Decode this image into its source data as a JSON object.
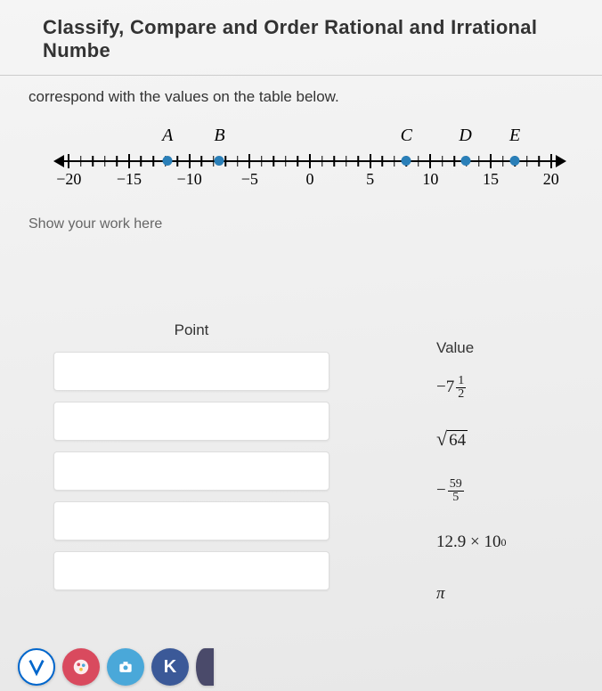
{
  "title": "Classify, Compare and Order Rational and Irrational Numbe",
  "instruction": "correspond with the values on the table below.",
  "number_line": {
    "min": -20,
    "max": 20,
    "ticks": [
      -20,
      -15,
      -10,
      -5,
      0,
      5,
      10,
      15,
      20
    ],
    "point_letters": [
      "A",
      "B",
      "C",
      "D",
      "E"
    ],
    "points_pos": [
      -11.8,
      -7.5,
      8,
      12.9,
      17
    ]
  },
  "show_work_label": "Show your work here",
  "table": {
    "point_header": "Point",
    "value_header": "Value",
    "values": [
      {
        "type": "mixed",
        "sign": "-",
        "whole": "7",
        "num": "1",
        "den": "2"
      },
      {
        "type": "sqrt",
        "arg": "64"
      },
      {
        "type": "frac",
        "sign": "-",
        "num": "59",
        "den": "5"
      },
      {
        "type": "sci",
        "coef": "12.9",
        "op": "×",
        "base": "10",
        "exp": "0"
      },
      {
        "type": "sym",
        "text": "π"
      }
    ]
  },
  "taskbar": {
    "items": [
      "v-icon",
      "palette-icon",
      "camera-icon",
      "k-icon",
      "app-icon"
    ]
  }
}
